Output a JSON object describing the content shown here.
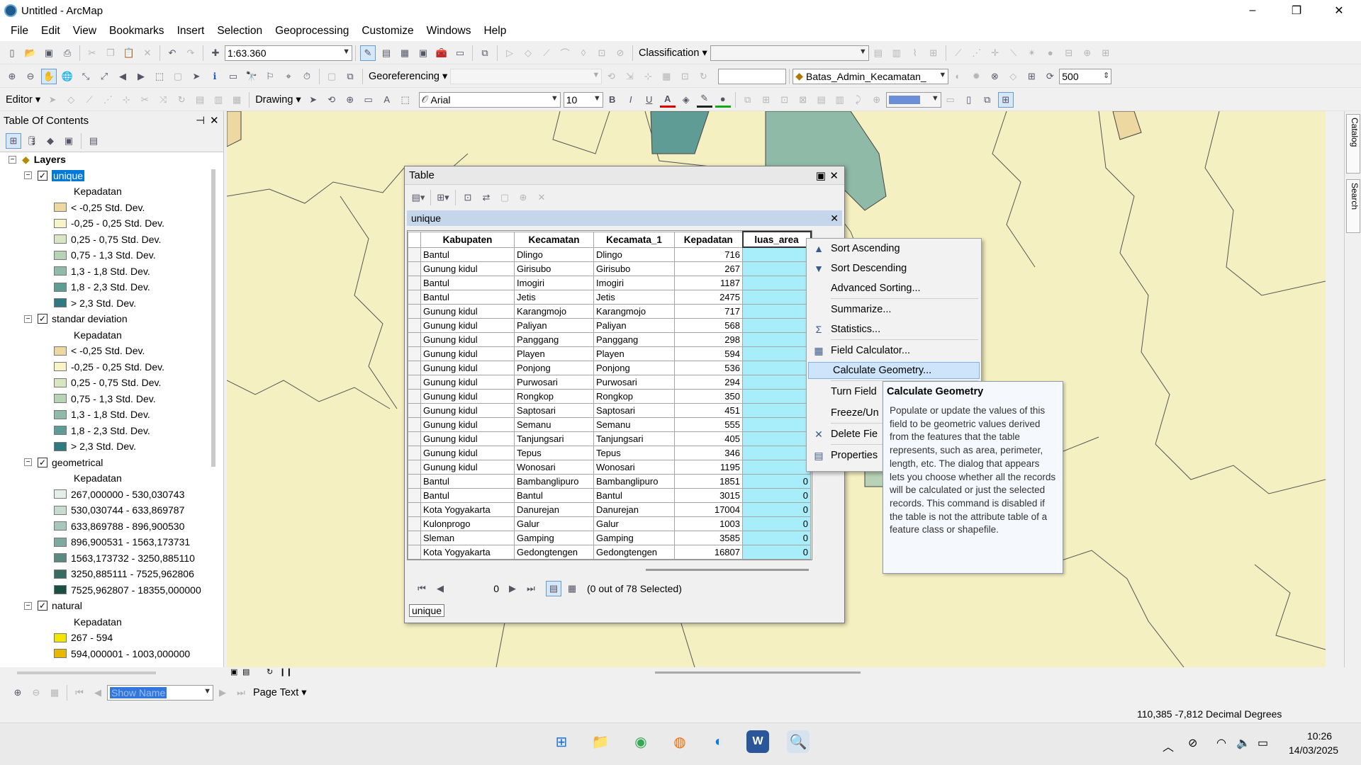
{
  "window": {
    "title": "Untitled - ArcMap",
    "minimize": "–",
    "maximize": "❐",
    "close": "✕"
  },
  "menu": [
    "File",
    "Edit",
    "View",
    "Bookmarks",
    "Insert",
    "Selection",
    "Geoprocessing",
    "Customize",
    "Windows",
    "Help"
  ],
  "toolbar": {
    "scale": "1:63.360",
    "classification": "Classification",
    "georeferencing": "Georeferencing",
    "layer_combo": "Batas_Admin_Kecamatan_",
    "resolution": "500",
    "editor": "Editor",
    "drawing": "Drawing",
    "font": "Arial",
    "font_size": "10",
    "bold": "B",
    "italic": "I",
    "underline": "U",
    "font_color": "A"
  },
  "toc": {
    "title": "Table Of Contents",
    "pin": "⊣",
    "close": "✕",
    "root": "Layers",
    "layers": [
      {
        "name": "unique",
        "field": "Kepadatan",
        "selected": true,
        "classes": [
          {
            "label": "< -0,25 Std. Dev.",
            "color": "#ecd8a0"
          },
          {
            "label": "-0,25 - 0,25 Std. Dev.",
            "color": "#f7f4c8"
          },
          {
            "label": "0,25 - 0,75 Std. Dev.",
            "color": "#d9e6c2"
          },
          {
            "label": "0,75 - 1,3 Std. Dev.",
            "color": "#b8d2b5"
          },
          {
            "label": "1,3 - 1,8 Std. Dev.",
            "color": "#8fbaa8"
          },
          {
            "label": "1,8 - 2,3 Std. Dev.",
            "color": "#5f9c95"
          },
          {
            "label": "> 2,3 Std. Dev.",
            "color": "#2f7a80"
          }
        ]
      },
      {
        "name": "standar deviation",
        "field": "Kepadatan",
        "classes": [
          {
            "label": "< -0,25 Std. Dev.",
            "color": "#ecd8a0"
          },
          {
            "label": "-0,25 - 0,25 Std. Dev.",
            "color": "#f7f4c8"
          },
          {
            "label": "0,25 - 0,75 Std. Dev.",
            "color": "#d9e6c2"
          },
          {
            "label": "0,75 - 1,3 Std. Dev.",
            "color": "#b8d2b5"
          },
          {
            "label": "1,3 - 1,8 Std. Dev.",
            "color": "#8fbaa8"
          },
          {
            "label": "1,8 - 2,3 Std. Dev.",
            "color": "#5f9c95"
          },
          {
            "label": "> 2,3 Std. Dev.",
            "color": "#2f7a80"
          }
        ]
      },
      {
        "name": "geometrical",
        "field": "Kepadatan",
        "classes": [
          {
            "label": "267,000000 - 530,030743",
            "color": "#e3efe8"
          },
          {
            "label": "530,030744 - 633,869787",
            "color": "#c6dcd2"
          },
          {
            "label": "633,869788 - 896,900530",
            "color": "#a6c8bc"
          },
          {
            "label": "896,900531 - 1563,173731",
            "color": "#7fa99e"
          },
          {
            "label": "1563,173732 - 3250,885110",
            "color": "#5a8a80"
          },
          {
            "label": "3250,885111 - 7525,962806",
            "color": "#386b62"
          },
          {
            "label": "7525,962807 - 18355,000000",
            "color": "#1b4f46"
          }
        ]
      },
      {
        "name": "natural",
        "field": "Kepadatan",
        "classes": [
          {
            "label": "267 - 594",
            "color": "#f2e600"
          },
          {
            "label": "594,000001 - 1003,000000",
            "color": "#e8b800"
          }
        ]
      }
    ]
  },
  "table_window": {
    "title": "Table",
    "table_name": "unique",
    "columns": [
      "Kabupaten",
      "Kecamatan",
      "Kecamata_1",
      "Kepadatan",
      "luas_area"
    ],
    "rows": [
      [
        "Bantul",
        "Dlingo",
        "Dlingo",
        "716",
        ""
      ],
      [
        "Gunung kidul",
        "Girisubo",
        "Girisubo",
        "267",
        ""
      ],
      [
        "Bantul",
        "Imogiri",
        "Imogiri",
        "1187",
        ""
      ],
      [
        "Bantul",
        "Jetis",
        "Jetis",
        "2475",
        ""
      ],
      [
        "Gunung kidul",
        "Karangmojo",
        "Karangmojo",
        "717",
        ""
      ],
      [
        "Gunung kidul",
        "Paliyan",
        "Paliyan",
        "568",
        ""
      ],
      [
        "Gunung kidul",
        "Panggang",
        "Panggang",
        "298",
        ""
      ],
      [
        "Gunung kidul",
        "Playen",
        "Playen",
        "594",
        ""
      ],
      [
        "Gunung kidul",
        "Ponjong",
        "Ponjong",
        "536",
        ""
      ],
      [
        "Gunung kidul",
        "Purwosari",
        "Purwosari",
        "294",
        ""
      ],
      [
        "Gunung kidul",
        "Rongkop",
        "Rongkop",
        "350",
        ""
      ],
      [
        "Gunung kidul",
        "Saptosari",
        "Saptosari",
        "451",
        ""
      ],
      [
        "Gunung kidul",
        "Semanu",
        "Semanu",
        "555",
        ""
      ],
      [
        "Gunung kidul",
        "Tanjungsari",
        "Tanjungsari",
        "405",
        ""
      ],
      [
        "Gunung kidul",
        "Tepus",
        "Tepus",
        "346",
        ""
      ],
      [
        "Gunung kidul",
        "Wonosari",
        "Wonosari",
        "1195",
        ""
      ],
      [
        "Bantul",
        "Bambanglipuro",
        "Bambanglipuro",
        "1851",
        "0"
      ],
      [
        "Bantul",
        "Bantul",
        "Bantul",
        "3015",
        "0"
      ],
      [
        "Kota Yogyakarta",
        "Danurejan",
        "Danurejan",
        "17004",
        "0"
      ],
      [
        "Kulonprogo",
        "Galur",
        "Galur",
        "1003",
        "0"
      ],
      [
        "Sleman",
        "Gamping",
        "Gamping",
        "3585",
        "0"
      ],
      [
        "Kota Yogyakarta",
        "Gedongtengen",
        "Gedongtengen",
        "16807",
        "0"
      ]
    ],
    "record": "0",
    "selected_status": "(0 out of 78 Selected)",
    "tab": "unique"
  },
  "context_menu": [
    {
      "label": "Sort Ascending",
      "icon": "sort-ascending-icon",
      "glyph": "▲"
    },
    {
      "label": "Sort Descending",
      "icon": "sort-descending-icon",
      "glyph": "▼"
    },
    {
      "label": "Advanced Sorting...",
      "icon": "",
      "glyph": ""
    },
    {
      "label": "Summarize...",
      "icon": "",
      "glyph": ""
    },
    {
      "label": "Statistics...",
      "icon": "sigma-icon",
      "glyph": "Σ"
    },
    {
      "label": "Field Calculator...",
      "icon": "calculator-icon",
      "glyph": "▦"
    },
    {
      "label": "Calculate Geometry...",
      "icon": "",
      "glyph": "",
      "highlighted": true
    },
    {
      "label": "Turn Field",
      "icon": "",
      "glyph": ""
    },
    {
      "label": "Freeze/Un",
      "icon": "",
      "glyph": ""
    },
    {
      "label": "Delete Fie",
      "icon": "delete-icon",
      "glyph": "✕"
    },
    {
      "label": "Properties",
      "icon": "properties-icon",
      "glyph": "▤"
    }
  ],
  "tooltip": {
    "title": "Calculate Geometry",
    "body": "Populate or update the values of this field to be geometric values derived from the features that the table represents, such as area, perimeter, length, etc. The dialog that appears lets you choose whether all the records will be calculated or just the selected records. This command is disabled if the table is not the attribute table of a feature class or shapefile."
  },
  "side_tabs": [
    "Catalog",
    "Search"
  ],
  "drawbar": {
    "show_name": "Show Name",
    "page_text": "Page Text"
  },
  "status": {
    "coords": "110,385  -7,812 Decimal Degrees"
  },
  "taskbar": {
    "time": "10:26",
    "date": "14/03/2025"
  },
  "colors": {
    "selection_blue": "#0078d7",
    "map_yellow": "#f5f0c2",
    "field_cyan": "#a7eefa",
    "menu_highlight": "#cde4fb"
  }
}
